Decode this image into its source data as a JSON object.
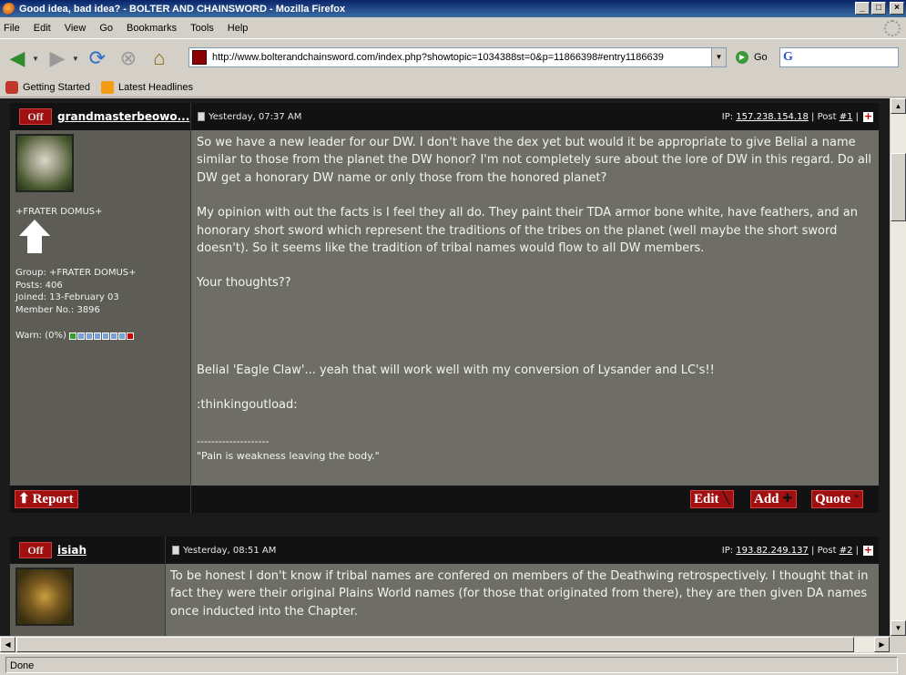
{
  "window": {
    "title": "Good idea, bad idea? - BOLTER AND CHAINSWORD - Mozilla Firefox"
  },
  "menu": [
    "File",
    "Edit",
    "View",
    "Go",
    "Bookmarks",
    "Tools",
    "Help"
  ],
  "toolbar": {
    "url": "http://www.bolterandchainsword.com/index.php?showtopic=1034388st=0&p=11866398#entry1186639",
    "go_label": "Go"
  },
  "bookmarks": [
    "Getting Started",
    "Latest Headlines"
  ],
  "status": {
    "text": "Done"
  },
  "posts": [
    {
      "status_badge": "Off",
      "username": "grandmasterbeowo...",
      "datetime": "Yesterday, 07:37 AM",
      "ip_label": "IP:",
      "ip": "157.238.154.18",
      "post_label": "Post",
      "post_no": "#1",
      "group_title": "+FRATER DOMUS+",
      "group": "Group: +FRATER DOMUS+",
      "posts": "Posts: 406",
      "joined": "Joined: 13-February 03",
      "member_no": "Member No.: 3896",
      "warn": "Warn: (0%)",
      "body": [
        "So we have a new leader for our DW. I don't have the dex yet but would it be appropriate to give Belial a name similar to those from the planet the DW honor? I'm not completely sure about the lore of DW in this regard. Do all DW get a honorary DW name or only those from the honored planet?",
        "My opinion with out the facts is I feel they all do. They paint their TDA armor bone white, have feathers, and an honorary short sword which represent the traditions of the tribes on the planet (well maybe the short sword doesn't). So it seems like the tradition of tribal names would flow to all DW members.",
        "Your thoughts??",
        "Belial 'Eagle Claw'... yeah that will work well with my conversion of Lysander and LC's!!",
        ":thinkingoutload:"
      ],
      "sig_rule": "--------------------",
      "signature": "\"Pain is weakness leaving the body.\"",
      "report_label": "Report",
      "edit_label": "Edit",
      "add_label": "Add",
      "quote_label": "Quote"
    },
    {
      "status_badge": "Off",
      "username": "isiah",
      "datetime": "Yesterday, 08:51 AM",
      "ip_label": "IP:",
      "ip": "193.82.249.137",
      "post_label": "Post",
      "post_no": "#2",
      "body": [
        "To be honest I don't know if tribal names are confered on members of the Deathwing retrospectively. I thought that in fact they were their original Plains World names (for those that originated from there), they are then given DA names once inducted into the Chapter."
      ]
    }
  ]
}
